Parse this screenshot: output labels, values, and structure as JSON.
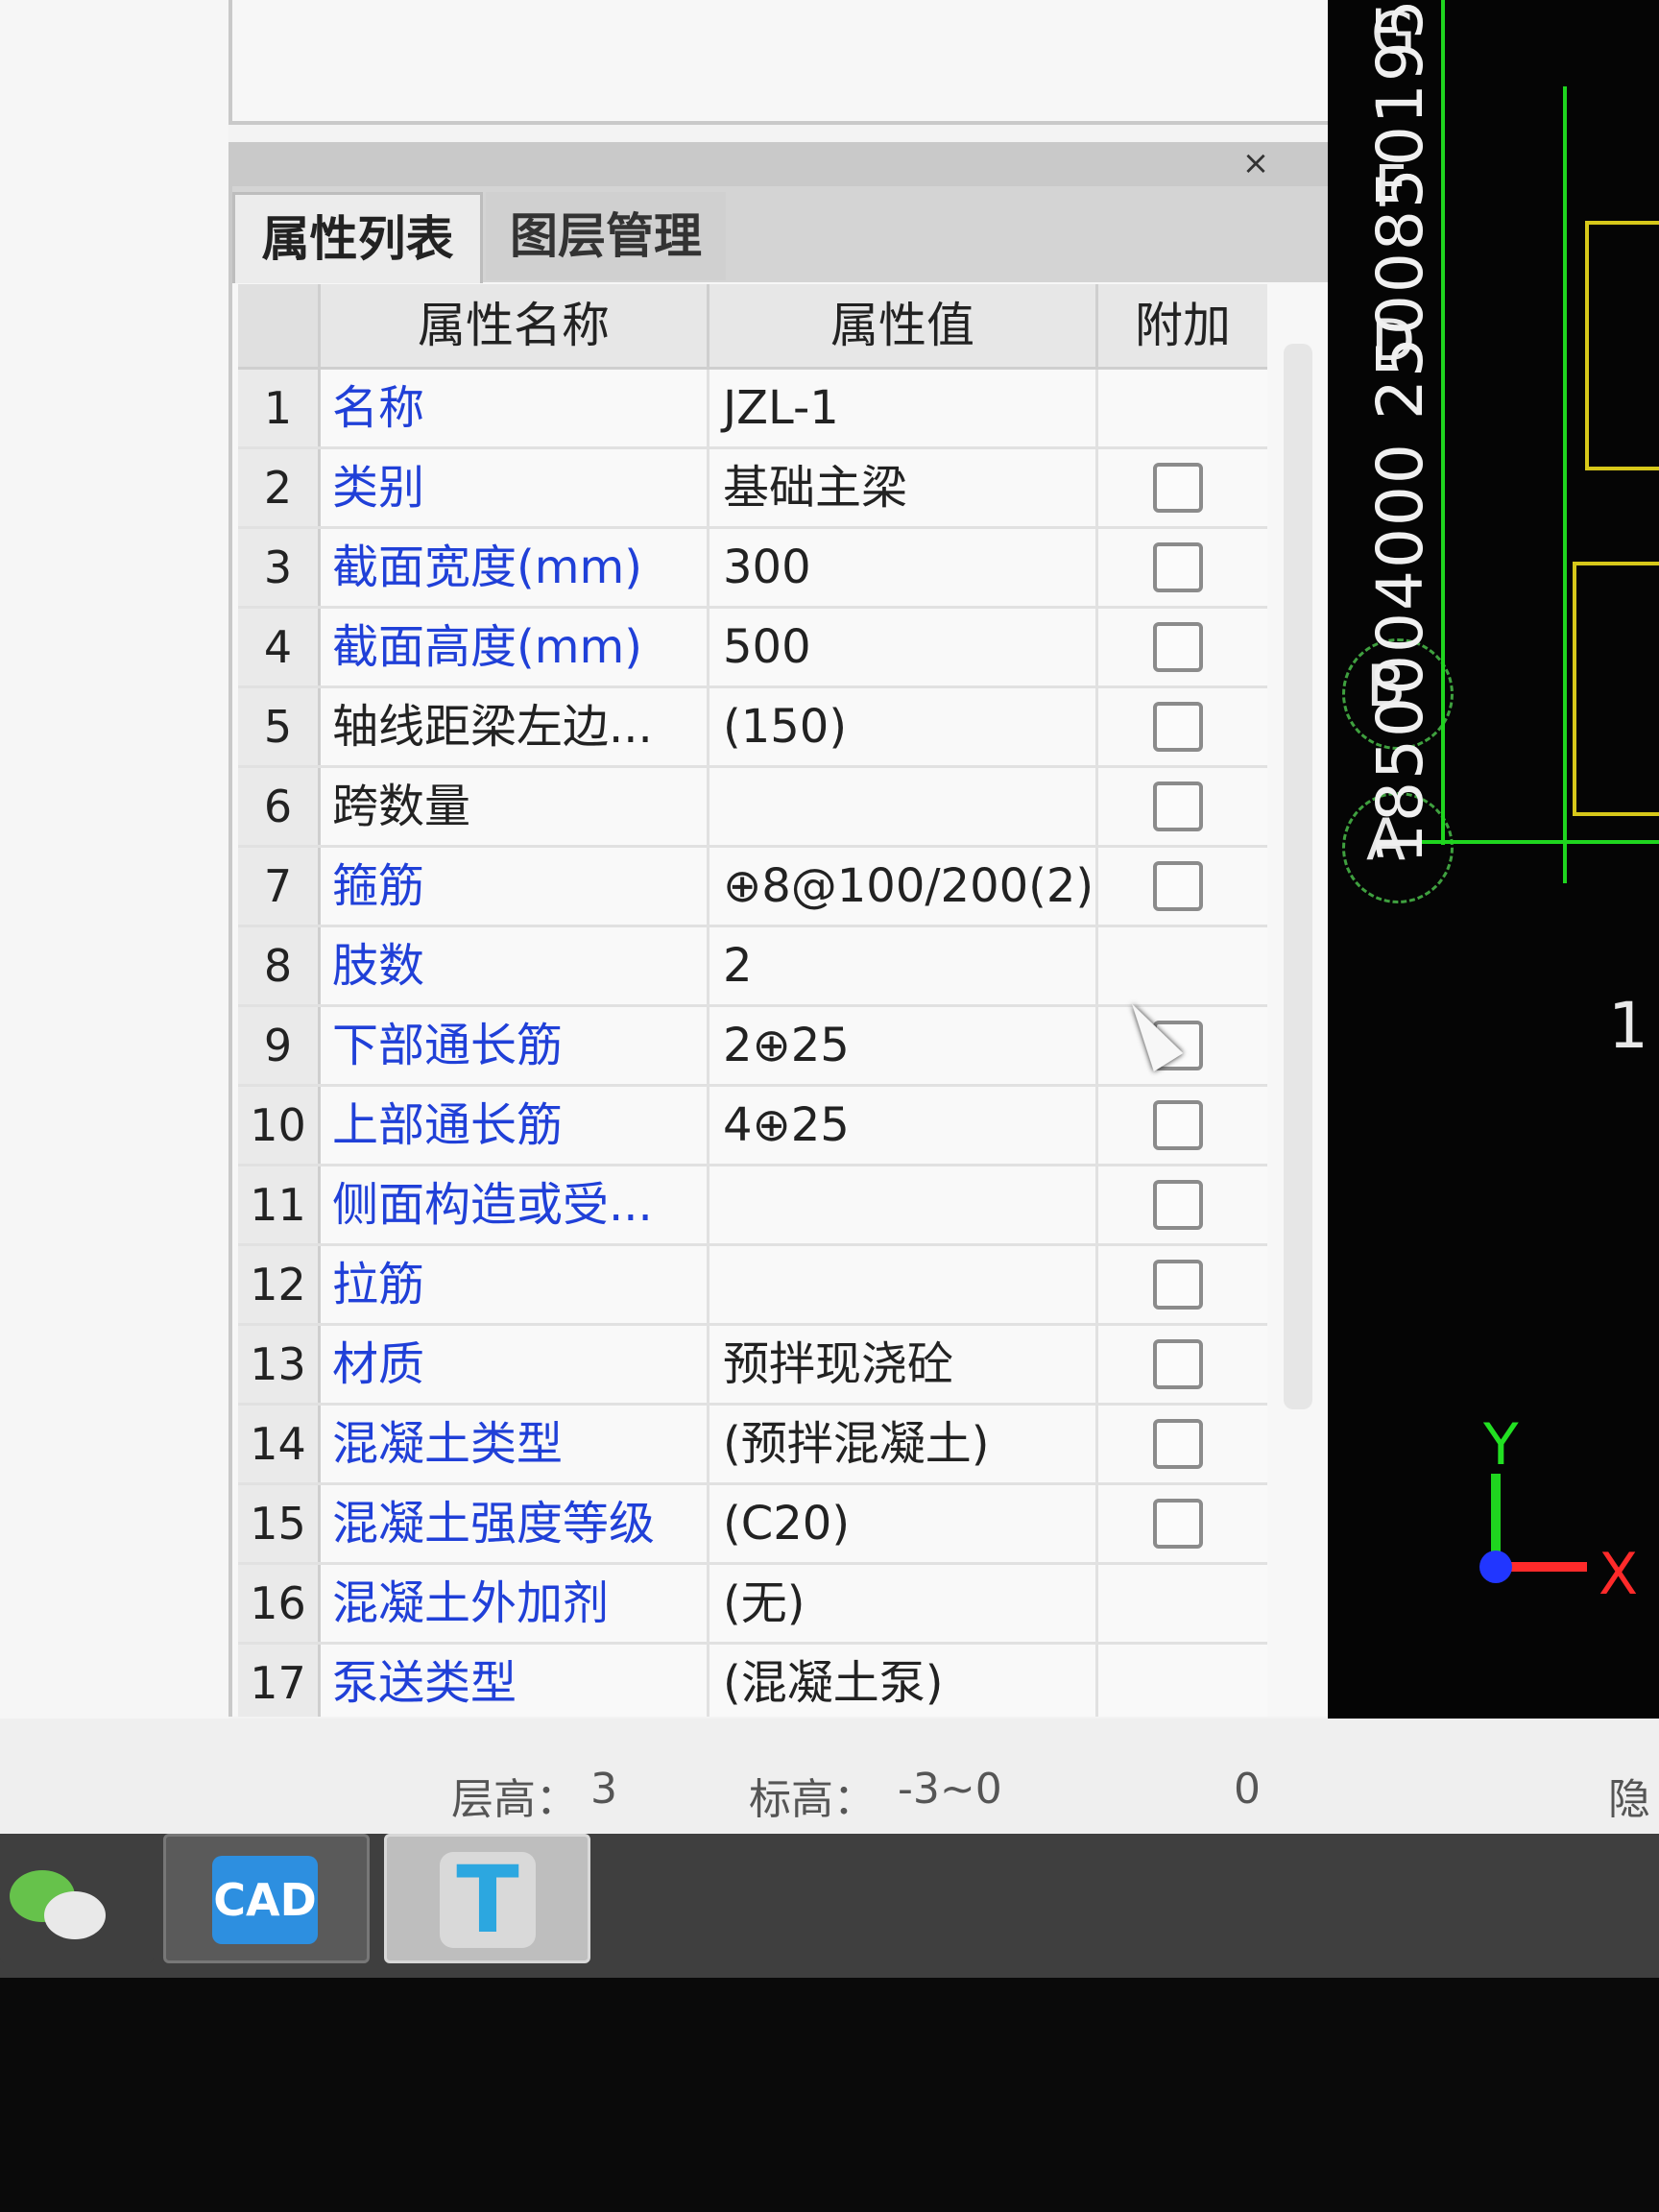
{
  "panel": {
    "close_glyph": "×",
    "tabs": [
      {
        "label": "属性列表",
        "active": true
      },
      {
        "label": "图层管理",
        "active": false
      }
    ],
    "columns": [
      "属性名称",
      "属性值",
      "附加"
    ],
    "rows": [
      {
        "num": "1",
        "name": "名称",
        "value": "JZL-1",
        "checkbox": false,
        "blue": true
      },
      {
        "num": "2",
        "name": "类别",
        "value": "基础主梁",
        "checkbox": true,
        "blue": true
      },
      {
        "num": "3",
        "name": "截面宽度(mm)",
        "value": "300",
        "checkbox": true,
        "blue": true
      },
      {
        "num": "4",
        "name": "截面高度(mm)",
        "value": "500",
        "checkbox": true,
        "blue": true
      },
      {
        "num": "5",
        "name": "轴线距梁左边...",
        "value": "(150)",
        "checkbox": true,
        "blue": false
      },
      {
        "num": "6",
        "name": "跨数量",
        "value": "",
        "checkbox": true,
        "blue": false
      },
      {
        "num": "7",
        "name": "箍筋",
        "value": "⊕8@100/200(2)",
        "checkbox": true,
        "blue": true
      },
      {
        "num": "8",
        "name": "肢数",
        "value": "2",
        "checkbox": false,
        "blue": true
      },
      {
        "num": "9",
        "name": "下部通长筋",
        "value": "2⊕25",
        "checkbox": true,
        "blue": true
      },
      {
        "num": "10",
        "name": "上部通长筋",
        "value": "4⊕25",
        "checkbox": true,
        "blue": true
      },
      {
        "num": "11",
        "name": "侧面构造或受...",
        "value": "",
        "checkbox": true,
        "blue": true
      },
      {
        "num": "12",
        "name": "拉筋",
        "value": "",
        "checkbox": true,
        "blue": true
      },
      {
        "num": "13",
        "name": "材质",
        "value": "预拌现浇砼",
        "checkbox": true,
        "blue": true
      },
      {
        "num": "14",
        "name": "混凝土类型",
        "value": "(预拌混凝土)",
        "checkbox": true,
        "blue": true
      },
      {
        "num": "15",
        "name": "混凝土强度等级",
        "value": "(C20)",
        "checkbox": true,
        "blue": true
      },
      {
        "num": "16",
        "name": "混凝土外加剂",
        "value": "(无)",
        "checkbox": false,
        "blue": true
      },
      {
        "num": "17",
        "name": "泵送类型",
        "value": "(混凝土泵)",
        "checkbox": false,
        "blue": true
      }
    ]
  },
  "cad": {
    "axis_labels": [
      "G",
      "F",
      "D",
      "B",
      "A"
    ],
    "dimension_text": "1850004000 2500850195 0",
    "ucs": {
      "x": "X",
      "y": "Y"
    },
    "right_number": "1"
  },
  "status": {
    "floor_height_label": "层高：",
    "floor_height_value": "3",
    "elevation_label": "标高：",
    "elevation_value": "-3~0",
    "extra_value": "0",
    "hidden_label": "隐"
  },
  "taskbar": {
    "apps": [
      {
        "label": "",
        "icon": "wechat-icon"
      },
      {
        "label": "CAD",
        "icon": "cad-icon"
      },
      {
        "label": "T",
        "icon": "t-app-icon"
      }
    ]
  },
  "colors": {
    "blue_name": "#2040d8",
    "cad_background": "#050505",
    "green": "#1fd51f",
    "yellow": "#d7c81a"
  }
}
